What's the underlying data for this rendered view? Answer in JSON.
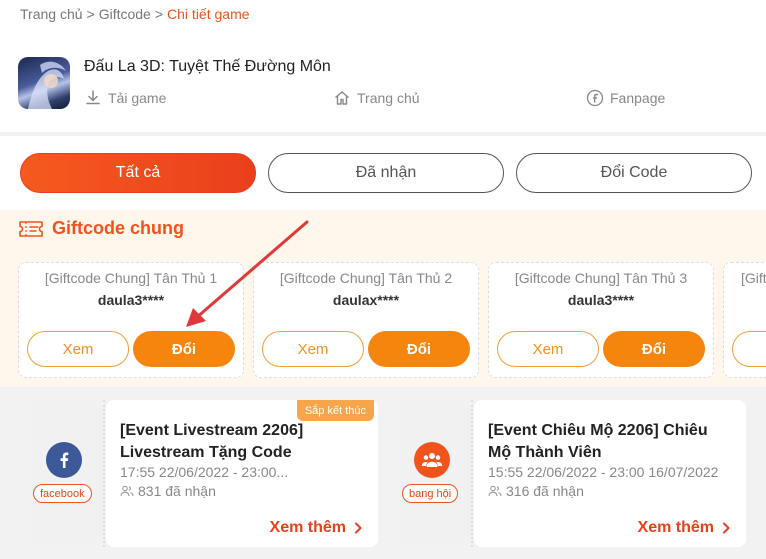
{
  "breadcrumb": {
    "home": "Trang chủ",
    "giftcode": "Giftcode",
    "current": "Chi tiết game",
    "separator": ">"
  },
  "game": {
    "title": "Đấu La 3D: Tuyệt Thế Đường Môn",
    "links": [
      {
        "label": "Tải game",
        "icon": "download-icon"
      },
      {
        "label": "Trang chủ",
        "icon": "home-icon"
      },
      {
        "label": "Fanpage",
        "icon": "facebook-circle-icon"
      }
    ]
  },
  "tabs": [
    {
      "label": "Tất cả",
      "active": true
    },
    {
      "label": "Đã nhận",
      "active": false
    },
    {
      "label": "Đổi Code",
      "active": false
    }
  ],
  "giftcode_section": {
    "title": "Giftcode chung",
    "icon": "ticket-icon",
    "cards": [
      {
        "name": "[Giftcode Chung] Tân Thủ 1",
        "code": "daula3****",
        "view_label": "Xem",
        "redeem_label": "Đổi"
      },
      {
        "name": "[Giftcode Chung] Tân Thủ 2",
        "code": "daulax****",
        "view_label": "Xem",
        "redeem_label": "Đổi"
      },
      {
        "name": "[Giftcode Chung] Tân Thủ 3",
        "code": "daula3****",
        "view_label": "Xem",
        "redeem_label": "Đổi"
      },
      {
        "name": "[Gift",
        "code": "",
        "view_label": "",
        "redeem_label": ""
      }
    ]
  },
  "events": [
    {
      "title": "[Event Livestream 2206] Livestream Tặng Code",
      "date": "17:55 22/06/2022 - 23:00...",
      "count": "831 đã nhận",
      "tag": "facebook",
      "icon": "facebook-icon",
      "ribbon": "Sắp kết thúc",
      "more": "Xem thêm"
    },
    {
      "title": "[Event Chiêu Mộ 2206] Chiêu Mộ Thành Viên",
      "date": "15:55 22/06/2022 - 23:00 16/07/2022",
      "count": "316 đã nhận",
      "tag": "bang hội",
      "icon": "guild-icon",
      "ribbon": "",
      "more": "Xem thêm"
    }
  ],
  "colors": {
    "accent": "#f0531c",
    "orange": "#f6850d",
    "section_bg": "#fff6ec",
    "facebook": "#3b5998"
  }
}
